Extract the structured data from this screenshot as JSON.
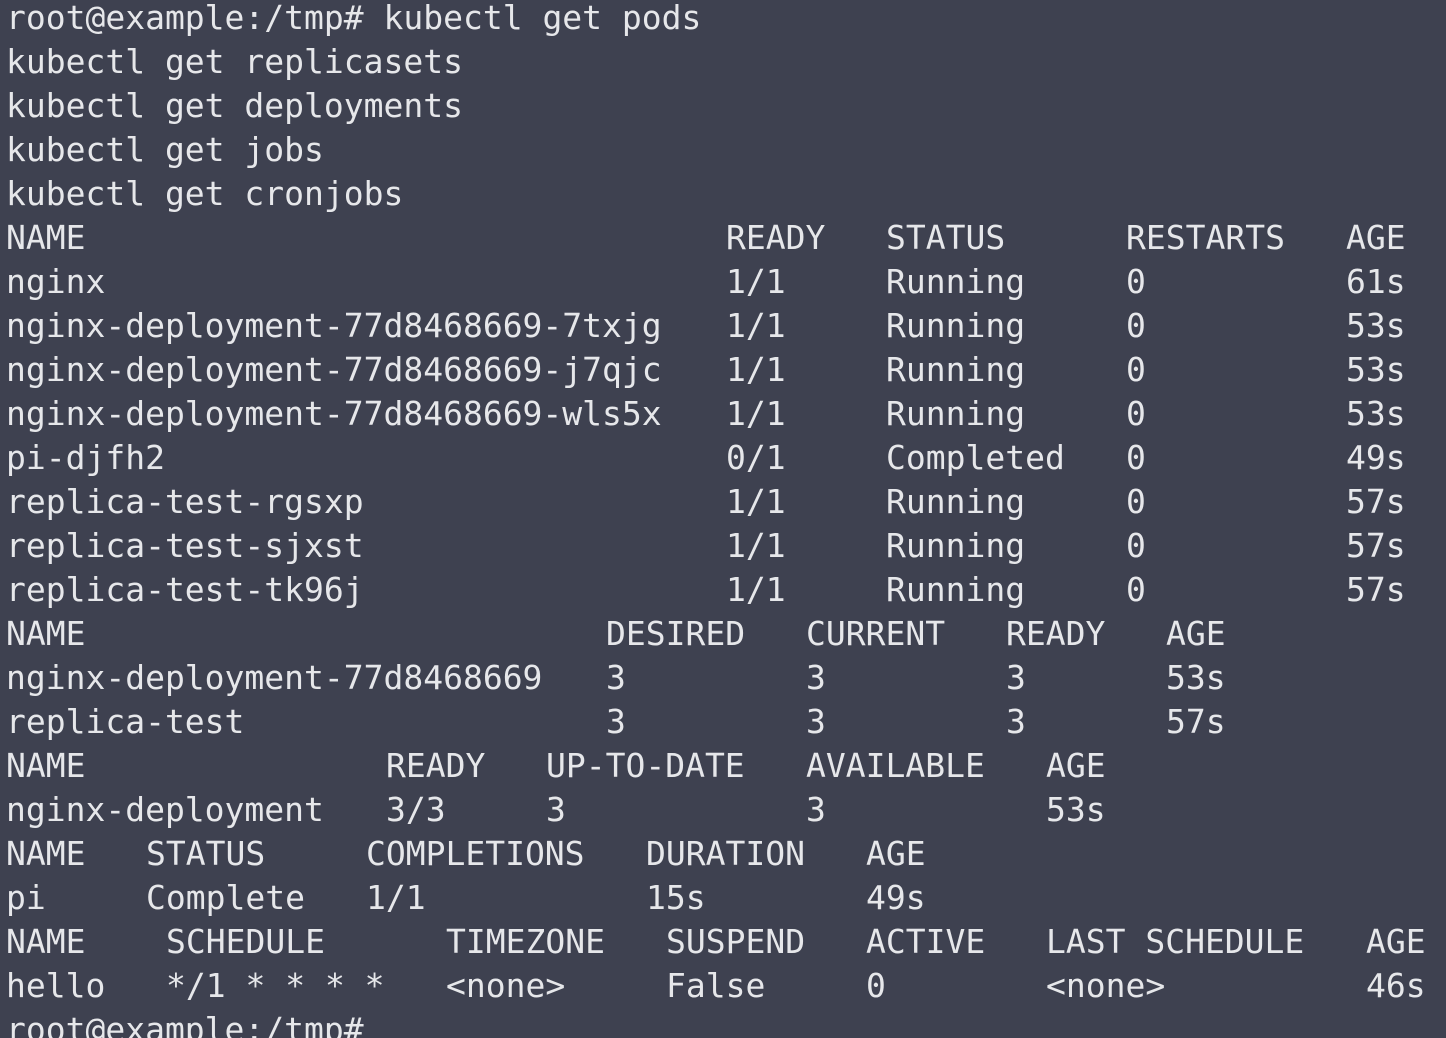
{
  "prompt": "root@example:/tmp# ",
  "commands": [
    "kubectl get pods",
    "kubectl get replicasets",
    "kubectl get deployments",
    "kubectl get jobs",
    "kubectl get cronjobs"
  ],
  "pods": {
    "headers": [
      "NAME",
      "READY",
      "STATUS",
      "RESTARTS",
      "AGE"
    ],
    "rows": [
      [
        "nginx",
        "1/1",
        "Running",
        "0",
        "61s"
      ],
      [
        "nginx-deployment-77d8468669-7txjg",
        "1/1",
        "Running",
        "0",
        "53s"
      ],
      [
        "nginx-deployment-77d8468669-j7qjc",
        "1/1",
        "Running",
        "0",
        "53s"
      ],
      [
        "nginx-deployment-77d8468669-wls5x",
        "1/1",
        "Running",
        "0",
        "53s"
      ],
      [
        "pi-djfh2",
        "0/1",
        "Completed",
        "0",
        "49s"
      ],
      [
        "replica-test-rgsxp",
        "1/1",
        "Running",
        "0",
        "57s"
      ],
      [
        "replica-test-sjxst",
        "1/1",
        "Running",
        "0",
        "57s"
      ],
      [
        "replica-test-tk96j",
        "1/1",
        "Running",
        "0",
        "57s"
      ]
    ]
  },
  "replicasets": {
    "headers": [
      "NAME",
      "DESIRED",
      "CURRENT",
      "READY",
      "AGE"
    ],
    "rows": [
      [
        "nginx-deployment-77d8468669",
        "3",
        "3",
        "3",
        "53s"
      ],
      [
        "replica-test",
        "3",
        "3",
        "3",
        "57s"
      ]
    ]
  },
  "deployments": {
    "headers": [
      "NAME",
      "READY",
      "UP-TO-DATE",
      "AVAILABLE",
      "AGE"
    ],
    "rows": [
      [
        "nginx-deployment",
        "3/3",
        "3",
        "3",
        "53s"
      ]
    ]
  },
  "jobs": {
    "headers": [
      "NAME",
      "STATUS",
      "COMPLETIONS",
      "DURATION",
      "AGE"
    ],
    "rows": [
      [
        "pi",
        "Complete",
        "1/1",
        "15s",
        "49s"
      ]
    ]
  },
  "cronjobs": {
    "headers": [
      "NAME",
      "SCHEDULE",
      "TIMEZONE",
      "SUSPEND",
      "ACTIVE",
      "LAST SCHEDULE",
      "AGE"
    ],
    "rows": [
      [
        "hello",
        "*/1 * * * *",
        "<none>",
        "False",
        "0",
        "<none>",
        "46s"
      ]
    ]
  },
  "colors": {
    "background": "#3e4150",
    "foreground": "#e6e7ea"
  }
}
